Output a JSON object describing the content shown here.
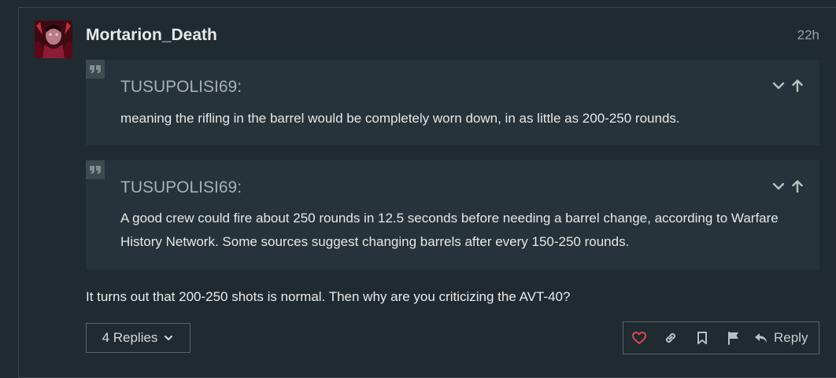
{
  "post": {
    "username": "Mortarion_Death",
    "date": "22h",
    "body": "It turns out that 200-250 shots is normal. Then why are you criticizing the AVT-40?"
  },
  "quotes": [
    {
      "author": "TUSUPOLISI69:",
      "text": "meaning the rifling in the barrel would be completely worn down, in as little as 200-250 rounds."
    },
    {
      "author": "TUSUPOLISI69:",
      "text": "A good crew could fire about 250 rounds in 12.5 seconds before needing a barrel change, according to Warfare History Network. Some sources suggest changing barrels after every 150-250 rounds."
    }
  ],
  "footer": {
    "replies_label": "4 Replies",
    "reply_label": "Reply"
  },
  "colors": {
    "background": "#1f2b30",
    "quote_background": "#26333a",
    "like_icon": "#e0474f",
    "text_muted": "#9aa2a5"
  },
  "icons": {
    "quote": "quote-icon",
    "collapse": "chevron-down-icon",
    "go_to_quote": "arrow-up-icon",
    "like": "heart-icon",
    "share": "link-icon",
    "bookmark": "bookmark-icon",
    "flag": "flag-icon",
    "reply": "reply-icon",
    "expand": "chevron-down-icon"
  }
}
